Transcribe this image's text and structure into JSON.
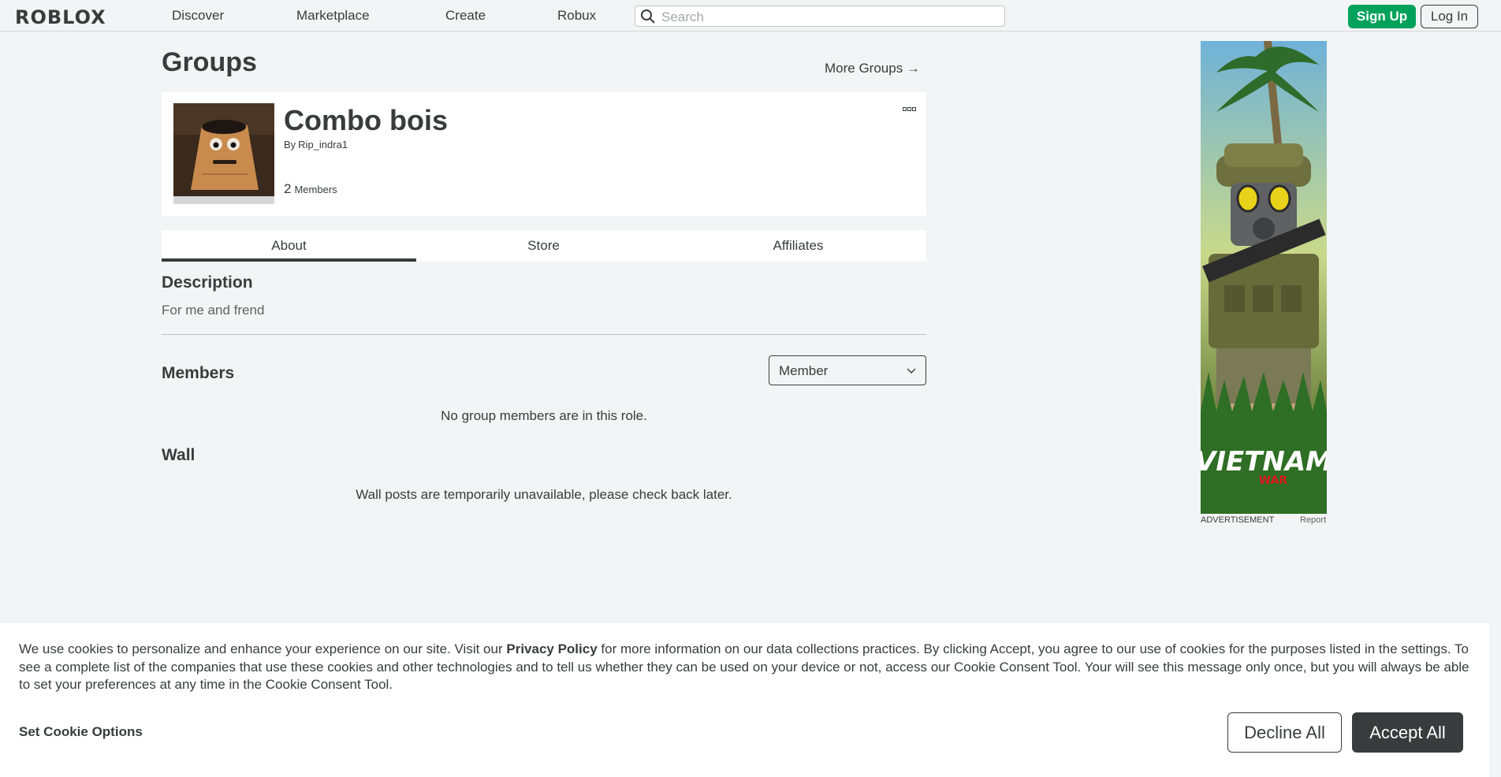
{
  "header": {
    "logo": "ROBLOX",
    "nav": [
      "Discover",
      "Marketplace",
      "Create",
      "Robux"
    ],
    "search_placeholder": "Search",
    "signup_label": "Sign Up",
    "login_label": "Log In"
  },
  "page": {
    "title": "Groups",
    "more_groups": "More Groups →"
  },
  "group": {
    "name": "Combo bois",
    "by_prefix": "By",
    "owner": "Rip_indra1",
    "member_count": "2",
    "member_label": "Members"
  },
  "tabs": [
    "About",
    "Store",
    "Affiliates"
  ],
  "about": {
    "description_title": "Description",
    "description": "For me and frend",
    "members_title": "Members",
    "role_selected": "Member",
    "members_empty": "No group members are in this role.",
    "wall_title": "Wall",
    "wall_note": "Wall posts are temporarily unavailable, please check back later."
  },
  "ad": {
    "label": "ADVERTISEMENT",
    "report": "Report",
    "art_text": "VIETNAM",
    "art_subtext": "WAR"
  },
  "cookie": {
    "text_before": "We use cookies to personalize and enhance your experience on our site. Visit our ",
    "link": "Privacy Policy",
    "text_after": " for more information on our data collections practices. By clicking Accept, you agree to our use of cookies for the purposes listed in the settings. To see a complete list of the companies that use these cookies and other technologies and to tell us whether they can be used on your device or not, access our Cookie Consent Tool. Your will see this message only once, but you will always be able to set your preferences at any time in the Cookie Consent Tool.",
    "options_label": "Set Cookie Options",
    "decline_label": "Decline All",
    "accept_label": "Accept All"
  },
  "colors": {
    "accent_green": "#00a25b",
    "text_dark": "#393b3d",
    "page_bg": "#f2f4f5"
  }
}
